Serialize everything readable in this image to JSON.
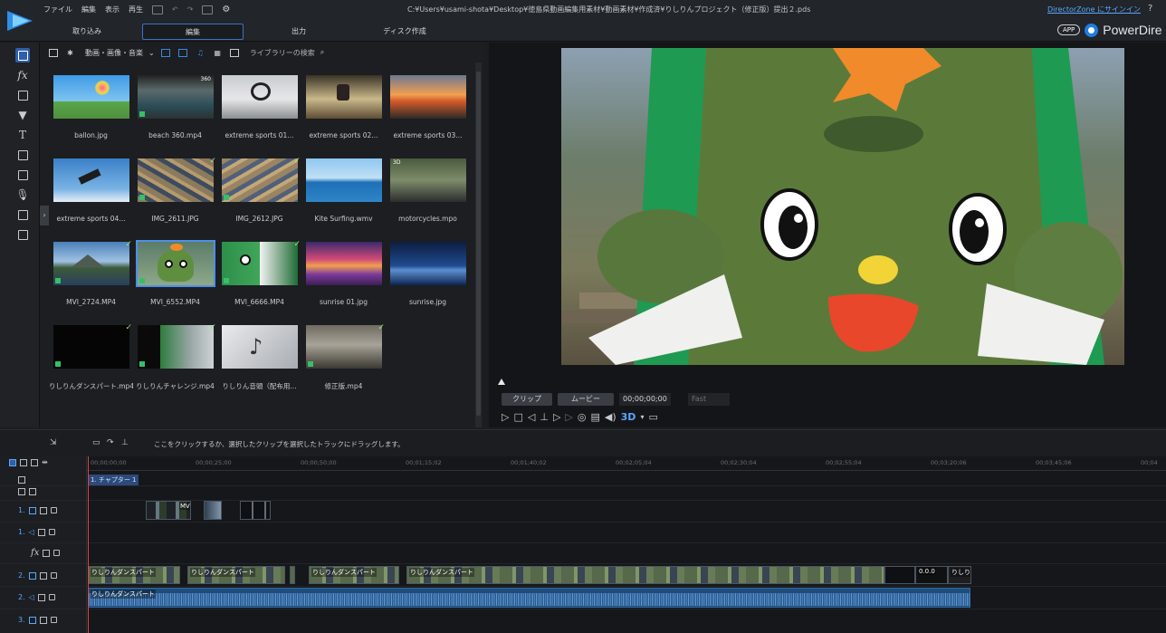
{
  "menu": {
    "file": "ファイル",
    "edit": "編集",
    "view": "表示",
    "play": "再生"
  },
  "window": {
    "filepath": "C:¥Users¥usami-shota¥Desktop¥徳島県動画編集用素材¥動画素材¥作成済¥りしりんプロジェクト（修正版）提出２.pds",
    "signin": "DirectorZone にサインイン",
    "help": "?"
  },
  "modes": [
    {
      "label": "取り込み",
      "active": false
    },
    {
      "label": "編集",
      "active": true
    },
    {
      "label": "出力",
      "active": false
    },
    {
      "label": "ディスク作成",
      "active": false
    }
  ],
  "brand": {
    "app_pill": "APP",
    "name": "PowerDire"
  },
  "library": {
    "filter": "動画・画像・音楽",
    "search_placeholder": "ライブラリーの検索",
    "items": [
      {
        "label": "ballon.jpg",
        "check": false,
        "badge": ""
      },
      {
        "label": "beach 360.mp4",
        "check": false,
        "badge": "360"
      },
      {
        "label": "extreme sports 01...",
        "check": false,
        "badge": ""
      },
      {
        "label": "extreme sports 02...",
        "check": false,
        "badge": ""
      },
      {
        "label": "extreme sports 03...",
        "check": false,
        "badge": ""
      },
      {
        "label": "extreme sports 04...",
        "check": false,
        "badge": ""
      },
      {
        "label": "IMG_2611.JPG",
        "check": true,
        "badge": ""
      },
      {
        "label": "IMG_2612.JPG",
        "check": true,
        "badge": ""
      },
      {
        "label": "Kite Surfing.wmv",
        "check": false,
        "badge": ""
      },
      {
        "label": "motorcycles.mpo",
        "check": false,
        "badge": "3D"
      },
      {
        "label": "MVI_2724.MP4",
        "check": true,
        "badge": ""
      },
      {
        "label": "MVI_6552.MP4",
        "check": false,
        "badge": ""
      },
      {
        "label": "MVI_6666.MP4",
        "check": true,
        "badge": ""
      },
      {
        "label": "sunrise 01.jpg",
        "check": false,
        "badge": ""
      },
      {
        "label": "sunrise.jpg",
        "check": false,
        "badge": ""
      },
      {
        "label": "りしりんダンスパート.mp4",
        "check": true,
        "badge": ""
      },
      {
        "label": "りしりんチャレンジ.mp4",
        "check": true,
        "badge": ""
      },
      {
        "label": "りしりん音頭（配布用...",
        "check": false,
        "badge": ""
      },
      {
        "label": "修正版.mp4",
        "check": true,
        "badge": ""
      }
    ]
  },
  "preview": {
    "tab_clip": "クリップ",
    "tab_movie": "ムービー",
    "timecode": "00;00;00;00",
    "quality": "Fast"
  },
  "timeline": {
    "hint": "ここをクリックするか、選択したクリップを選択したトラックにドラッグします。",
    "ruler": [
      "00;00;00;00",
      "00;00;25;00",
      "00;00;50;00",
      "00;01;15;02",
      "00;01;40;02",
      "00;02;05;04",
      "00;02;30;04",
      "00;02;55;04",
      "00;03;20;06",
      "00;03;45;06",
      "00;04"
    ],
    "chapter": "1. チャプター 1",
    "tracks": [
      {
        "label": "",
        "kind": "chapter"
      },
      {
        "label": "",
        "kind": "subtitle"
      },
      {
        "label": "1.",
        "kind": "video"
      },
      {
        "label": "1.",
        "kind": "audio"
      },
      {
        "label": "",
        "kind": "fx"
      },
      {
        "label": "2.",
        "kind": "video"
      },
      {
        "label": "2.",
        "kind": "audio"
      },
      {
        "label": "3.",
        "kind": "video"
      }
    ],
    "video2_clips": [
      "りしりんダンスパート",
      "りしりんダンスパート",
      "りしりんダンスパート",
      "りしりんダンスパート",
      "りしりんダンスパート",
      "0.0.0",
      "りしり"
    ],
    "audio2_clip": "りしりんダンスパート",
    "track1_clip_label": "MV"
  },
  "colors": {
    "accent": "#3b72c8",
    "check": "#9be07a",
    "playhead": "#d9473d"
  }
}
